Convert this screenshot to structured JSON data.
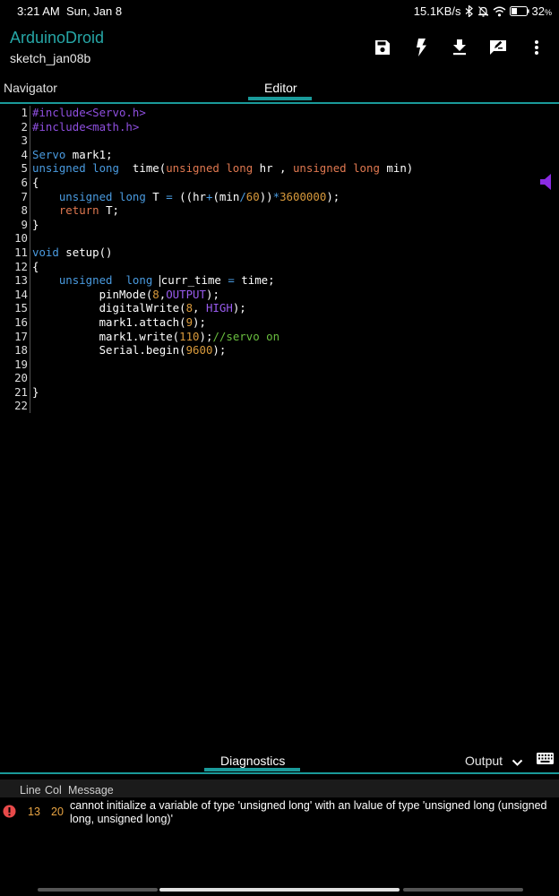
{
  "status_bar": {
    "time": "3:21 AM",
    "date": "Sun, Jan 8",
    "net_speed": "15.1KB/s",
    "battery": "32"
  },
  "app": {
    "title": "ArduinoDroid",
    "subtitle": "sketch_jan08b",
    "title_color": "#26a6a6",
    "toolbar_icons": [
      "save-icon",
      "flash-icon",
      "download-icon",
      "edit-note-icon",
      "more-vert-icon"
    ]
  },
  "tabs": {
    "navigator": "Navigator",
    "editor": "Editor",
    "active": "Editor"
  },
  "editor": {
    "line_numbers": [
      "1",
      "2",
      "3",
      "4",
      "5",
      "6",
      "7",
      "8",
      "9",
      "10",
      "11",
      "12",
      "13",
      "14",
      "15",
      "16",
      "17",
      "18",
      "19",
      "20",
      "21",
      "22"
    ],
    "lines": [
      "#include<Servo.h>",
      "#include<math.h>",
      "",
      "Servo mark1;",
      "unsigned long  time(unsigned long hr , unsigned long min)",
      "{",
      "    unsigned long T = ((hr+(min/60))*3600000);",
      "    return T;",
      "}",
      "",
      "void setup()",
      "{",
      "    unsigned  long curr_time = time;",
      "          pinMode(8,OUTPUT);",
      "          digitalWrite(8, HIGH);",
      "          mark1.attach(9);",
      "          mark1.write(110);//servo on",
      "          Serial.begin(9600);",
      "",
      "",
      "}",
      ""
    ]
  },
  "bottom_panel": {
    "diagnostics_tab": "Diagnostics",
    "output_tab": "Output",
    "headers": {
      "line": "Line",
      "col": "Col",
      "message": "Message"
    },
    "rows": [
      {
        "line": "13",
        "col": "20",
        "message": "cannot initialize a variable of type 'unsigned long' with an lvalue of type 'unsigned long (unsigned long, unsigned long)'"
      }
    ]
  },
  "colors": {
    "accent": "#1a9a9a",
    "preprocessor": "#8f4fe0",
    "type": "#4a9be0",
    "keyword": "#e07850",
    "number": "#d99a3c",
    "constant": "#9a5cf0",
    "comment": "#6abf3f",
    "error": "#e84a4a",
    "warn_number": "#e8a443"
  }
}
